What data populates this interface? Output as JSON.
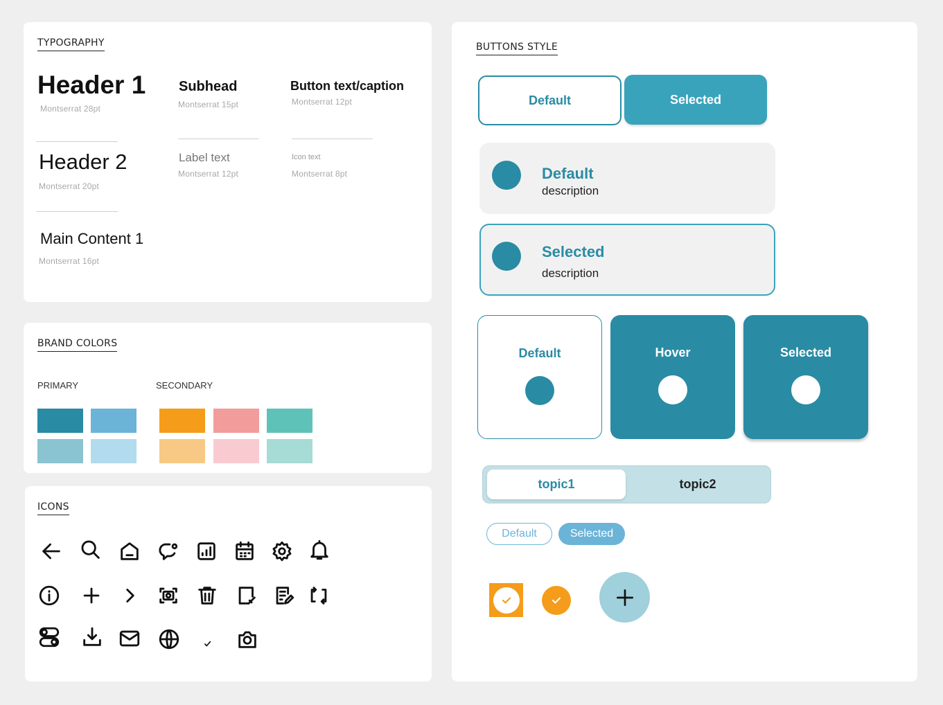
{
  "typography": {
    "title": "TYPOGRAPHY",
    "h1": {
      "label": "Header 1",
      "meta": "Montserrat  28pt"
    },
    "subhead": {
      "label": "Subhead",
      "meta": "Montserrat  15pt"
    },
    "button_text": {
      "label": "Button text/caption",
      "meta": "Montserrat  12pt"
    },
    "h2": {
      "label": "Header 2",
      "meta": "Montserrat  20pt"
    },
    "label_text": {
      "label": "Label text",
      "meta": "Montserrat  12pt"
    },
    "icon_text": {
      "label": "Icon text",
      "meta": "Montserrat  8pt"
    },
    "main_content": {
      "label": "Main Content 1",
      "meta": "Montserrat  16pt"
    }
  },
  "brand_colors": {
    "title": "BRAND COLORS",
    "primary_label": "PRIMARY",
    "secondary_label": "SECONDARY",
    "primary": [
      "#2a8ba4",
      "#6bb4d8",
      "#8ac4d0",
      "#b3dbee"
    ],
    "secondary": [
      "#f59c1a",
      "#f29c9c",
      "#5fc2b9",
      "#f8c984",
      "#f8cbd0",
      "#a6dbd6"
    ]
  },
  "icons": {
    "title": "ICONS",
    "row1": [
      "arrow-left-icon",
      "search-icon",
      "home-icon",
      "chat-bubble-icon",
      "bar-chart-icon",
      "calendar-icon",
      "gear-icon",
      "bell-icon"
    ],
    "row2": [
      "info-icon",
      "plus-icon",
      "chevron-right-icon",
      "screenshot-icon",
      "trash-icon",
      "note-icon",
      "edit-document-icon",
      "repeat-icon"
    ],
    "row3": [
      "toggle-icon",
      "download-icon",
      "mail-icon",
      "globe-icon",
      "check-icon",
      "camera-icon"
    ]
  },
  "buttons": {
    "title": "BUTTONS STYLE",
    "segment": {
      "default": "Default",
      "selected": "Selected"
    },
    "list_default": {
      "title": "Default",
      "desc": "description"
    },
    "list_selected": {
      "title": "Selected",
      "desc": "description"
    },
    "cards": {
      "default": "Default",
      "hover": "Hover",
      "selected": "Selected"
    },
    "tabs": {
      "tab1": "topic1",
      "tab2": "topic2"
    },
    "chips": {
      "default": "Default",
      "selected": "Selected"
    },
    "colors": {
      "accent": "#2a8ba4",
      "accent_light": "#39a3bc",
      "fab": "#9fd0db",
      "orange": "#f59c1a"
    }
  }
}
